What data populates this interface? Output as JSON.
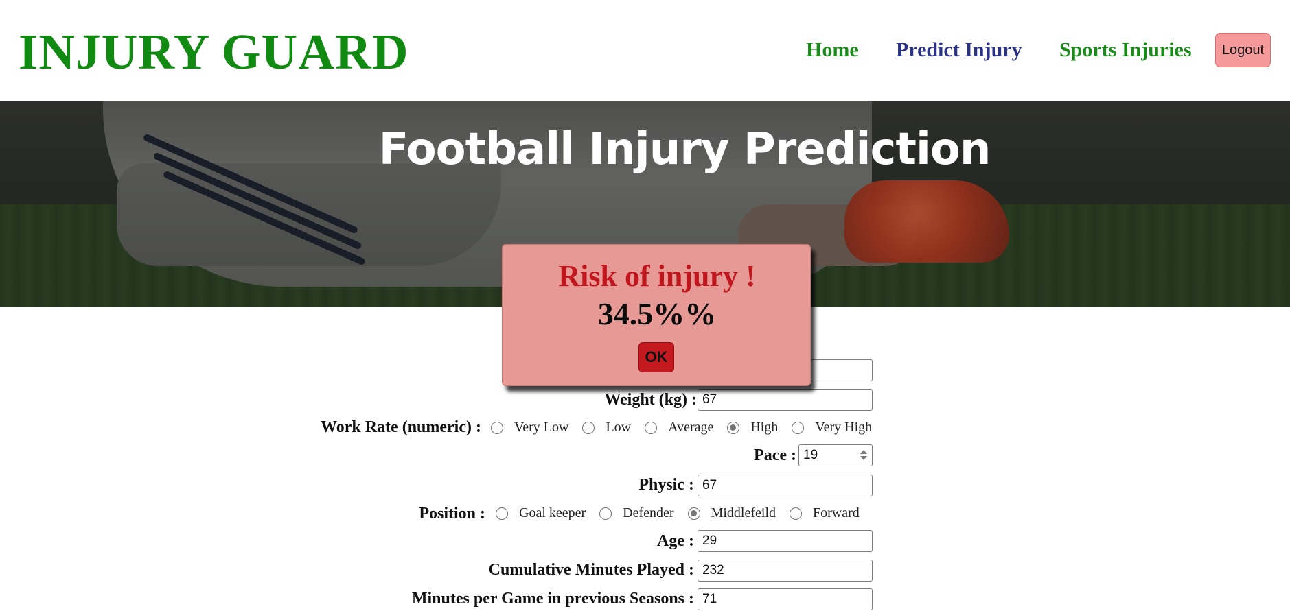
{
  "header": {
    "logo": "INJURY GUARD",
    "nav": {
      "home": "Home",
      "predict": "Predict Injury",
      "sports": "Sports Injuries"
    },
    "logout_label": "Logout"
  },
  "hero": {
    "title": "Football Injury Prediction"
  },
  "form": {
    "weight": {
      "label": "Weight (kg) :",
      "value": "67"
    },
    "work_rate": {
      "label": "Work Rate (numeric) :",
      "options": [
        "Very Low",
        "Low",
        "Average",
        "High",
        "Very High"
      ],
      "selected": "High"
    },
    "pace": {
      "label": "Pace :",
      "value": "19"
    },
    "physic": {
      "label": "Physic :",
      "value": "67"
    },
    "position": {
      "label": "Position :",
      "options": [
        "Goal keeper",
        "Defender",
        "Middlefeild",
        "Forward"
      ],
      "selected": "Middlefeild"
    },
    "age": {
      "label": "Age :",
      "value": "29"
    },
    "cumulative_minutes": {
      "label": "Cumulative Minutes Played :",
      "value": "232"
    },
    "minutes_per_game": {
      "label": "Minutes per Game in previous Seasons :",
      "value": "71"
    }
  },
  "modal": {
    "title": "Risk of injury !",
    "value": "34.5%%",
    "ok_label": "OK"
  },
  "colors": {
    "logo_green": "#118a11",
    "nav_blue": "#2a3286",
    "logout_bg": "#f49a9a",
    "modal_bg": "#e79a95",
    "modal_title": "#c0161e",
    "ok_bg": "#c41a1f"
  }
}
